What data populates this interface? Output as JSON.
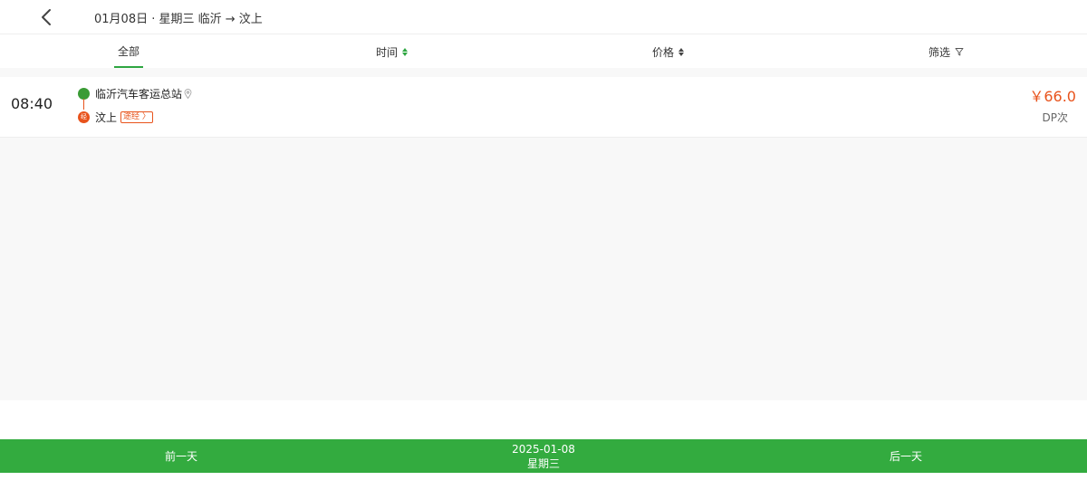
{
  "header": {
    "back_icon": "chevron-left-icon",
    "title": "01月08日 · 星期三 临沂 → 汶上"
  },
  "tabs": [
    {
      "label": "全部",
      "active": true
    },
    {
      "label": "时间",
      "icon": "sort-icon",
      "active_color": "#2ea641"
    },
    {
      "label": "价格",
      "icon": "sort-icon"
    },
    {
      "label": "筛选",
      "icon": "funnel-icon"
    }
  ],
  "trips": [
    {
      "time": "08:40",
      "start_station": "临沂汽车客运总站",
      "start_icon": "location-pin-icon",
      "via_marker": "经",
      "end_station": "汶上",
      "end_badge": "途经 〉",
      "price": "￥66.0",
      "remaining": "DP次"
    }
  ],
  "footer": {
    "prev_label": "前一天",
    "date": "2025-01-08",
    "weekday": "星期三",
    "next_label": "后一天"
  },
  "colors": {
    "accent": "#33ab3f",
    "price": "#e8531c",
    "start_dot": "#3a9b35"
  }
}
